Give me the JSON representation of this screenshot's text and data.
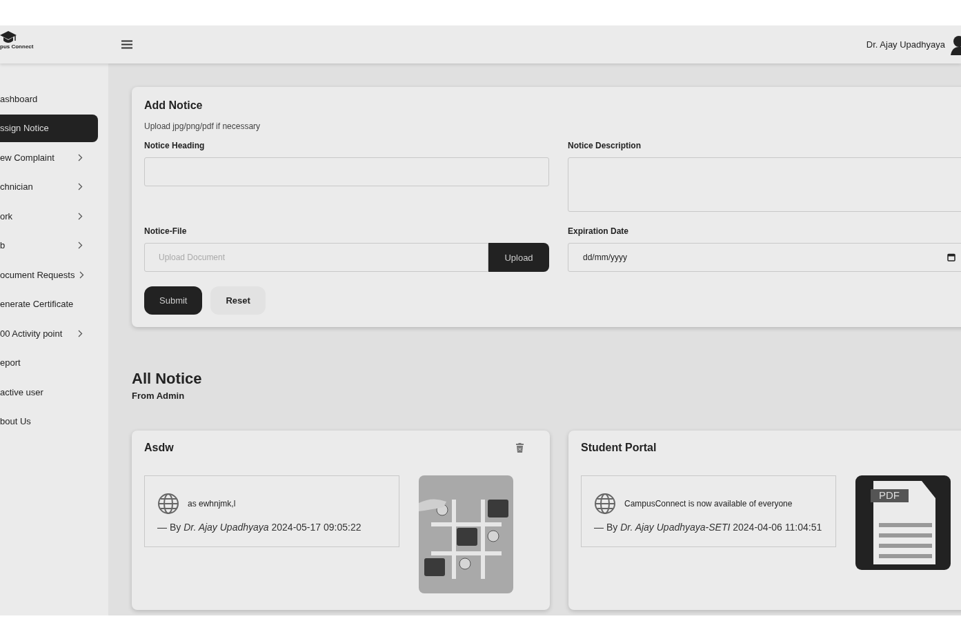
{
  "header": {
    "logo_caption": "pus Connect",
    "user_name": "Dr. Ajay Upadhyaya"
  },
  "sidebar": {
    "items": [
      {
        "label": "ashboard",
        "selected": false,
        "expandable": false
      },
      {
        "label": "ssign Notice",
        "selected": true,
        "expandable": false
      },
      {
        "label": "ew Complaint",
        "selected": false,
        "expandable": true
      },
      {
        "label": "chnician",
        "selected": false,
        "expandable": true
      },
      {
        "label": "ork",
        "selected": false,
        "expandable": true
      },
      {
        "label": "b",
        "selected": false,
        "expandable": true
      },
      {
        "label": "ocument Requests",
        "selected": false,
        "expandable": true
      },
      {
        "label": "enerate Certificate",
        "selected": false,
        "expandable": false
      },
      {
        "label": "00 Activity point",
        "selected": false,
        "expandable": true
      },
      {
        "label": "eport",
        "selected": false,
        "expandable": false
      },
      {
        "label": "active user",
        "selected": false,
        "expandable": false
      },
      {
        "label": "bout Us",
        "selected": false,
        "expandable": false
      }
    ]
  },
  "form": {
    "title": "Add Notice",
    "hint": "Upload jpg/png/pdf if necessary",
    "heading_label": "Notice Heading",
    "description_label": "Notice Description",
    "file_label": "Notice-File",
    "file_placeholder": "Upload Document",
    "upload_button": "Upload",
    "date_label": "Expiration Date",
    "date_placeholder": "dd/mm/yyyy",
    "submit_button": "Submit",
    "reset_button": "Reset"
  },
  "notices_section": {
    "title": "All Notice",
    "subtitle": "From Admin"
  },
  "notices": [
    {
      "title": "Asdw",
      "deletable": true,
      "message": "as ewhnjmk,l",
      "byline": "— By *Dr. Ajay Upadhyaya* 2024-05-17 09:05:22"
    },
    {
      "title": "Student Portal",
      "deletable": false,
      "message": "CampusConnect is now available of everyone",
      "byline": "— By *Dr. Ajay Upadhyaya-SETI* 2024-04-06 11:04:51",
      "attachment": {
        "kind": "pdf",
        "label": "PDF"
      }
    }
  ]
}
